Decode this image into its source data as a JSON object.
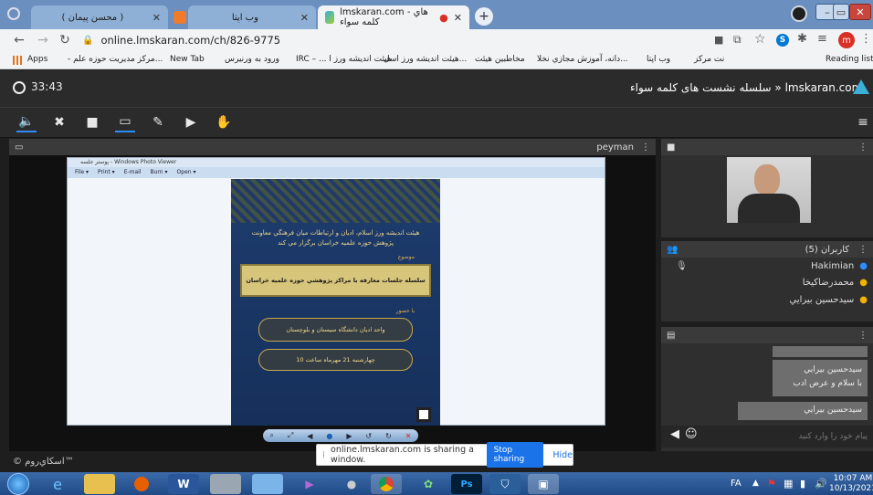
{
  "browser": {
    "tabs": [
      {
        "title": "( محسن پيمان )",
        "active": false
      },
      {
        "title": "وب اپتا",
        "active": false
      },
      {
        "title": "lmskaran.com - هاي كلمه سواء",
        "active": true
      }
    ],
    "new_tab_label": "+",
    "url": "online.lmskaran.com/ch/826-9775",
    "bookmarks": [
      "Apps",
      "- مركز مديريت حوزه علم...",
      "New Tab",
      "ورود به ورنيرس",
      "IRC – ... هيئت انديشه ورز ا",
      "هيئت انديشه ورز اسل...",
      "مخاطبين هيئت",
      "دانه، آموزش مجازي نخلا...",
      "وب اپتا",
      "نت مركز"
    ],
    "reading_list": "Reading list",
    "profile_letter": "m"
  },
  "app": {
    "timer": "33:43",
    "brand": "lmskaran.com",
    "session_title": "سلسله نشست های كلمه سواء",
    "breadcrumb_sep": "»",
    "presenter": "peyman",
    "users_header": "كاربران (5)",
    "users": [
      "Hakimian",
      "محمدرضاكيخا",
      "سيدحسين بيرايي"
    ],
    "chat_messages": [
      {
        "text": "سيدحسين بيرايي",
        "kind": "name"
      },
      {
        "text": "با سلام و عرض ادب",
        "kind": "msg"
      },
      {
        "text": "سيدحسين بيرايي",
        "kind": "name"
      }
    ],
    "chat_placeholder": "پيام خود را وارد كنيد",
    "footer_brand": "© اسكاي‌روم™"
  },
  "share_bar": {
    "message": "online.lmskaran.com is sharing a window.",
    "stop_label": "Stop sharing",
    "hide_label": "Hide"
  },
  "viewer": {
    "window_title": "پوستر جلسه - Windows Photo Viewer",
    "menu": [
      "File ▾",
      "Print ▾",
      "E-mail",
      "Burn ▾",
      "Open ▾"
    ],
    "poster": {
      "intro": "هيئت انديشه ورز اسلام، اديان و ارتباطات ميان فرهنگي معاونت پژوهش حوزه علميه خراسان برگزار مي كند",
      "topic_label": "موضوع",
      "topic": "سلسله جلسات معارفه با مراكز پژوهشي حوزه علميه خراسان",
      "guest_label": "با حضور",
      "guest": "واحد اديان دانشگاه سيستان و بلوچستان",
      "date": "چهارشنبه 21 مهرماه ساعت 10"
    }
  },
  "taskbar": {
    "lang": "FA",
    "time": "10:07 AM",
    "date": "10/13/2021"
  }
}
